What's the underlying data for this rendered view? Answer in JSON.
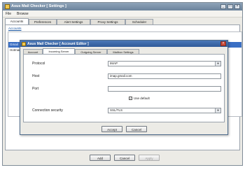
{
  "window": {
    "title": "Asus Mail Checker [ Settings ]",
    "controls": [
      "_",
      "□",
      "×"
    ]
  },
  "menu": {
    "items": [
      "File",
      "Browse"
    ]
  },
  "tabs": [
    "Accounts",
    "Preferences",
    "Alert Settings",
    "Proxy Settings",
    "Scheduler"
  ],
  "accounts": {
    "label": "Accounts",
    "rows": [
      "Gmail",
      "Hotmail"
    ]
  },
  "footer": {
    "add": "Add",
    "cancel": "Cancel",
    "apply": "Apply"
  },
  "dialog": {
    "title": "Asus Mail Checker [ Account Editor ]",
    "close": "×",
    "tabs": [
      "Account",
      "Incoming Server",
      "Outgoing Server",
      "Mailbox Settings"
    ],
    "fields": {
      "protocol_label": "Protocol",
      "protocol_value": "IMAP",
      "host_label": "Host",
      "host_value": "imap.gmail.com",
      "port_label": "Port",
      "port_value": "",
      "use_default_label": "Use default",
      "use_default_checked": true,
      "connection_label": "Connection security",
      "connection_value": "SSL/TLS"
    },
    "buttons": {
      "accept": "Accept",
      "cancel": "Cancel"
    }
  }
}
